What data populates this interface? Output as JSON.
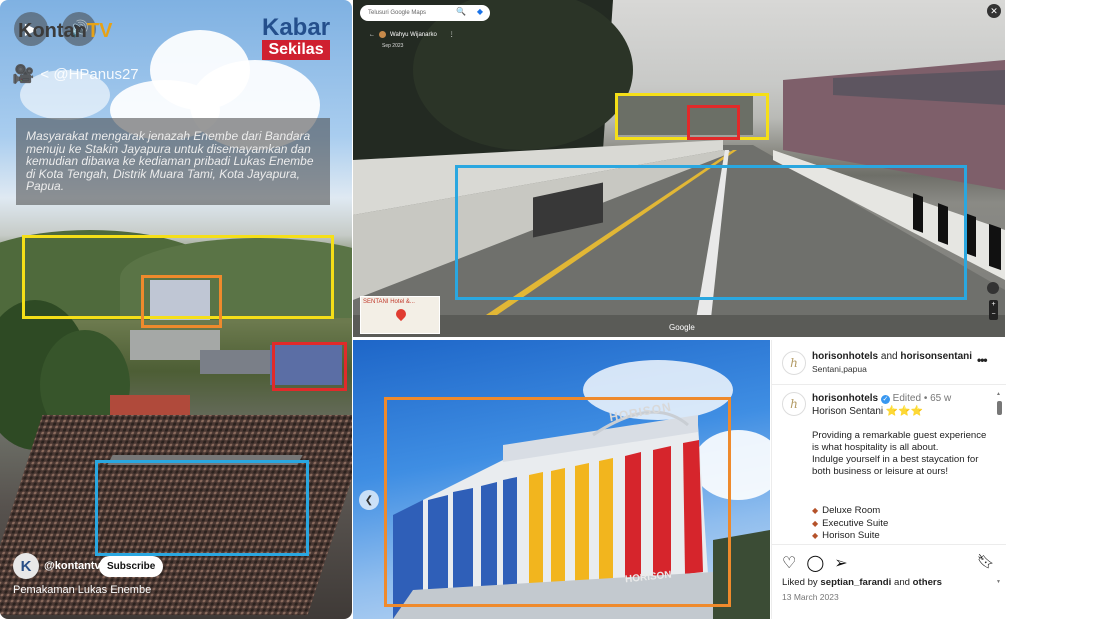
{
  "colors": {
    "highlight_yellow": "#f5df18",
    "highlight_orange": "#ef8a2c",
    "highlight_red": "#e12a2a",
    "highlight_blue": "#2aa7e0",
    "hotel_blue": "#2f5fb8",
    "hotel_yellow": "#f2b51e",
    "hotel_red": "#d6252c"
  },
  "video": {
    "play_icon": "play-icon",
    "volume_icon": "volume-icon",
    "logo_main": "Kontan",
    "logo_accent": "TV",
    "badge_line1": "Kabar",
    "badge_line2": "Sekilas",
    "camera_icon": "camera-icon",
    "handle": "< @HPanus27",
    "caption": "Masyarakat mengarak jenazah Enembe dari Bandara menuju ke Stakin Jayapura untuk disemayamkan dan kemudian dibawa ke kediaman pribadi Lukas Enembe di Kota Tengah, Distrik Muara Tami, Kota Jayapura, Papua.",
    "channel_initial": "K",
    "channel_name": "@kontantv",
    "subscribe_label": "Subscribe",
    "title": "Pemakaman Lukas Enembe"
  },
  "streetview": {
    "search_placeholder": "Telusuri Google Maps",
    "owner": "Wahyu Wijanarko",
    "date": "Sep 2023",
    "minimap_label": "SENTANI Hotel &...",
    "google_label": "Google"
  },
  "hotel_photo": {
    "sign_top": "HORISON",
    "sign_bottom": "HORISON"
  },
  "instagram": {
    "header_user1": "horisonhotels",
    "header_and": " and ",
    "header_user2": "horisonsentani",
    "location": "Sentani,papua",
    "more_label": "•••",
    "post_user": "horisonhotels",
    "post_meta": " Edited • 65 w",
    "post_title": "Horison Sentani ⭐⭐⭐",
    "body_line1": "Providing a remarkable guest experience is what hospitality is all about.",
    "body_line2": "Indulge yourself in a best staycation for both business or leisure at ours!",
    "list": [
      "Deluxe Room",
      "Executive Suite",
      "Horison Suite"
    ],
    "liked_prefix": "Liked by ",
    "liked_user": "septian_farandi",
    "liked_and": " and ",
    "liked_others": "others",
    "date": "13 March 2023"
  }
}
